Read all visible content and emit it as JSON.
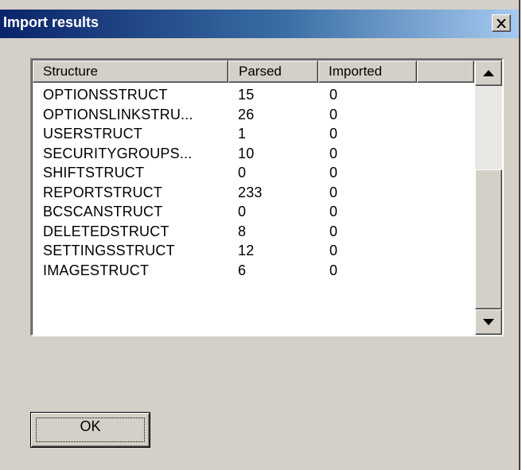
{
  "window": {
    "title": "Import results",
    "close_glyph": "✕"
  },
  "list": {
    "columns": [
      "Structure",
      "Parsed",
      "Imported",
      ""
    ],
    "rows": [
      {
        "structure": "OPTIONSSTRUCT",
        "parsed": "15",
        "imported": "0"
      },
      {
        "structure": "OPTIONSLINKSTRU...",
        "parsed": "26",
        "imported": "0"
      },
      {
        "structure": "USERSTRUCT",
        "parsed": "1",
        "imported": "0"
      },
      {
        "structure": "SECURITYGROUPS...",
        "parsed": "10",
        "imported": "0"
      },
      {
        "structure": "SHIFTSTRUCT",
        "parsed": "0",
        "imported": "0"
      },
      {
        "structure": "REPORTSTRUCT",
        "parsed": "233",
        "imported": "0"
      },
      {
        "structure": "BCSCANSTRUCT",
        "parsed": "0",
        "imported": "0"
      },
      {
        "structure": "DELETEDSTRUCT",
        "parsed": "8",
        "imported": "0"
      },
      {
        "structure": "SETTINGSSTRUCT",
        "parsed": "12",
        "imported": "0"
      },
      {
        "structure": "IMAGESTRUCT",
        "parsed": "6",
        "imported": "0"
      }
    ],
    "scrollbar": {
      "up_icon": "scroll-up-arrow-icon",
      "down_icon": "scroll-down-arrow-icon"
    }
  },
  "buttons": {
    "ok_label": "OK"
  },
  "colors": {
    "title_gradient_start": "#0a246a",
    "title_gradient_end": "#a6caf0",
    "dialog_face": "#d4d0c8"
  }
}
